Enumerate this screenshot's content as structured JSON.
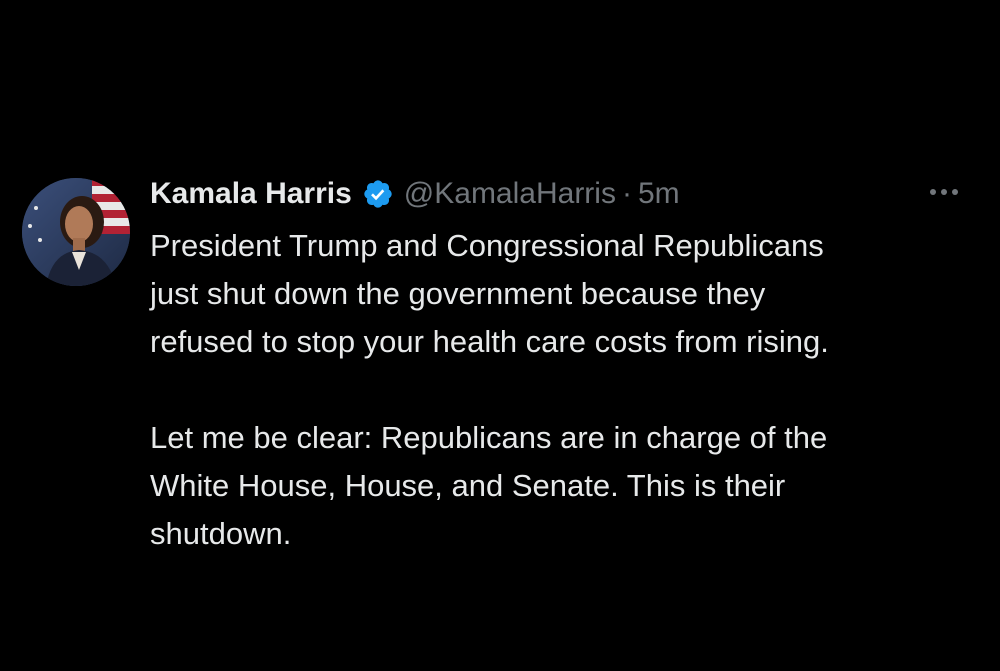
{
  "tweet": {
    "author": {
      "display_name": "Kamala Harris",
      "handle": "@KamalaHarris",
      "verified_icon": "verified-badge-icon",
      "avatar": "profile-photo"
    },
    "separator": "·",
    "timestamp": "5m",
    "more_icon": "more-options-icon",
    "paragraphs": [
      "President Trump and Congressional Republicans\njust shut down the government because they\nrefused to stop your health care costs from rising.",
      "Let me be clear: Republicans are in charge of the\nWhite House, House, and Senate. This is their\nshutdown."
    ]
  },
  "colors": {
    "background": "#000000",
    "primary_text": "#e7e9ea",
    "secondary_text": "#71767b",
    "verified_blue": "#1d9bf0"
  }
}
